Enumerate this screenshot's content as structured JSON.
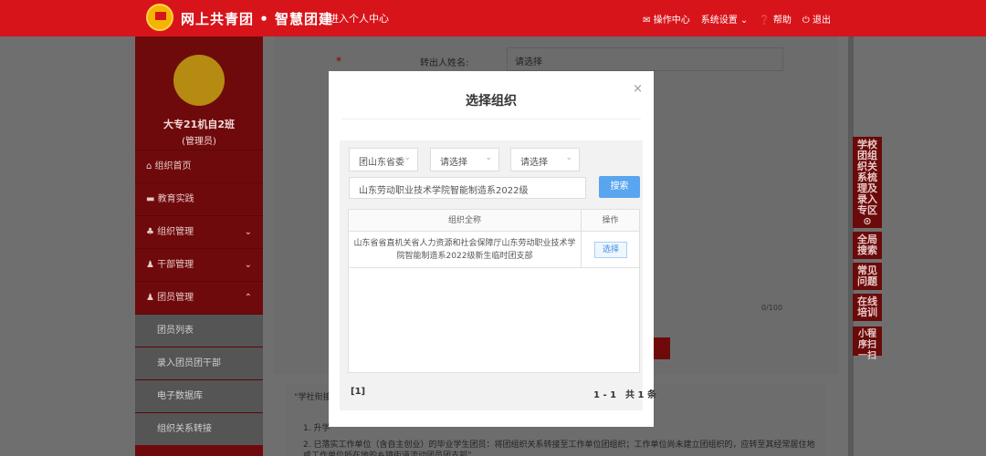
{
  "header": {
    "site_title": "网上共青团 • 智慧团建",
    "center_link": "进入个人中心",
    "nav": [
      "✉ 操作中心",
      "系统设置 ⌄",
      "❓ 帮助",
      "⏻ 退出"
    ]
  },
  "sidebar": {
    "class_name": "大专21机自2班",
    "role": "(管理员)",
    "items": [
      {
        "label": "组织首页",
        "icon": "home-icon"
      },
      {
        "label": "教育实践",
        "icon": "folder-icon"
      },
      {
        "label": "组织管理",
        "icon": "org-icon",
        "expand": "⌄"
      },
      {
        "label": "干部管理",
        "icon": "users-icon",
        "expand": "⌄"
      },
      {
        "label": "团员管理",
        "icon": "users-icon",
        "expand": "⌃"
      }
    ],
    "subitems": [
      "团员列表",
      "录入团员团干部",
      "电子数据库",
      "组织关系转接"
    ]
  },
  "form": {
    "required_mark": "*",
    "transfer_name_label": "转出人姓名:",
    "transfer_name_value": "请选择",
    "counter": "0/100"
  },
  "notice": {
    "title": "“学社衔接",
    "line1": "1. 升学",
    "line2": "2. 已落实工作单位（含自主创业）的毕业学生团员：将团组织关系转接至工作单位团组织；工作单位尚未建立团组织的，应转至其经常居住地",
    "line2b": "或工作单位所在地的乡镇街道流动团员团支部”"
  },
  "right_sidebar": [
    "学校团组织关系梳理及录入专区 ⊙",
    "全局搜索",
    "常见问题",
    "在线培训",
    "小程序扫一扫"
  ],
  "modal": {
    "title": "选择组织",
    "close": "×",
    "select1": "团山东省委",
    "select2": "请选择",
    "select3": "请选择",
    "search_value": "山东劳动职业技术学院智能制造系2022级",
    "search_button": "搜索",
    "table": {
      "col_name": "组织全称",
      "col_op": "操作",
      "rows": [
        {
          "name": "山东省省直机关省人力资源和社会保障厅山东劳动职业技术学院智能制造系2022级新生临时团支部",
          "op": "选择"
        }
      ]
    },
    "pager_left": "[1]",
    "pager_right": "1 - 1　共 1 条"
  }
}
